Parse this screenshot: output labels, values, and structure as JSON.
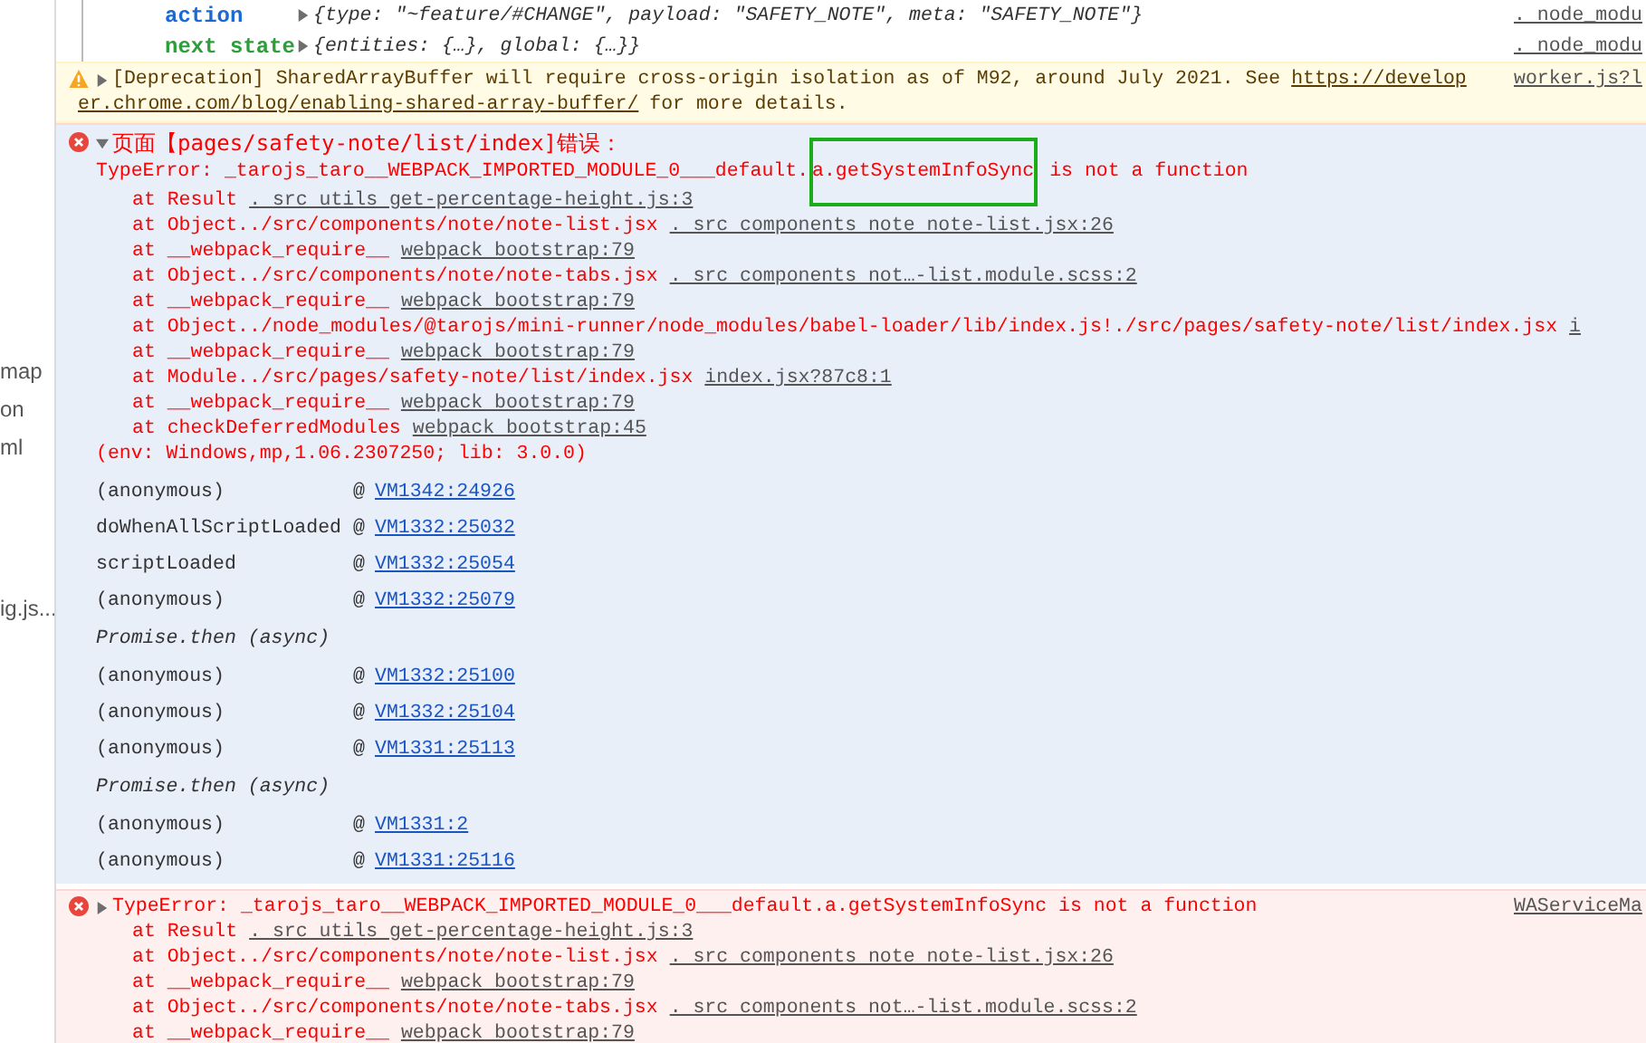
{
  "sidebar_fragments": [
    "map",
    "on",
    "ml",
    "ig.js..."
  ],
  "state_rows": [
    {
      "label": "action",
      "value": "{type: \"~feature/#CHANGE\", payload: \"SAFETY_NOTE\", meta: \"SAFETY_NOTE\"}",
      "source": ". node_modu"
    },
    {
      "label": "next state",
      "value": "{entities: {…}, global: {…}}",
      "source": ". node_modu"
    }
  ],
  "warning": {
    "text": "[Deprecation] SharedArrayBuffer will require cross-origin isolation as of M92, around July 2021. See",
    "link_start": "https://develop",
    "link_end": "er.chrome.com/blog/enabling-shared-array-buffer/",
    "text_end": "for more details.",
    "source": "worker.js?l"
  },
  "error_group": {
    "expanded": true,
    "title": "页面【pages/safety-note/list/index]错误：",
    "message_before": "TypeError: _tarojs_taro__WEBPACK_IMPORTED_MODULE_0___default.",
    "highlight": "a.getSystemInfoSync",
    "message_after": "is not a function",
    "stack": [
      {
        "text": "at Result",
        "link": ". src utils get-percentage-height.js:3"
      },
      {
        "text": "at Object../src/components/note/note-list.jsx",
        "link": ". src components note note-list.jsx:26"
      },
      {
        "text": "at __webpack_require__",
        "link": "webpack bootstrap:79"
      },
      {
        "text": "at Object../src/components/note/note-tabs.jsx",
        "link": ". src components not…-list.module.scss:2"
      },
      {
        "text": "at __webpack_require__",
        "link": "webpack bootstrap:79"
      },
      {
        "text": "at Object../node_modules/@tarojs/mini-runner/node_modules/babel-loader/lib/index.js!./src/pages/safety-note/list/index.jsx",
        "link": "i"
      },
      {
        "text": "at __webpack_require__",
        "link": "webpack bootstrap:79"
      },
      {
        "text": "at Module../src/pages/safety-note/list/index.jsx",
        "link": "index.jsx?87c8:1"
      },
      {
        "text": "at __webpack_require__",
        "link": "webpack bootstrap:79"
      },
      {
        "text": "at checkDeferredModules",
        "link": "webpack bootstrap:45"
      }
    ],
    "env": "(env: Windows,mp,1.06.2307250; lib: 3.0.0)",
    "call_stack": [
      {
        "kind": "frame",
        "name": "(anonymous)",
        "at": "@",
        "link": "VM1342:24926"
      },
      {
        "kind": "frame",
        "name": "doWhenAllScriptLoaded",
        "at": "@",
        "link": "VM1332:25032"
      },
      {
        "kind": "frame",
        "name": "scriptLoaded",
        "at": "@",
        "link": "VM1332:25054"
      },
      {
        "kind": "frame",
        "name": "(anonymous)",
        "at": "@",
        "link": "VM1332:25079"
      },
      {
        "kind": "async",
        "name": "Promise.then (async)"
      },
      {
        "kind": "frame",
        "name": "(anonymous)",
        "at": "@",
        "link": "VM1332:25100"
      },
      {
        "kind": "frame",
        "name": "(anonymous)",
        "at": "@",
        "link": "VM1332:25104"
      },
      {
        "kind": "frame",
        "name": "(anonymous)",
        "at": "@",
        "link": "VM1331:25113"
      },
      {
        "kind": "async",
        "name": "Promise.then (async)"
      },
      {
        "kind": "frame",
        "name": "(anonymous)",
        "at": "@",
        "link": "VM1331:2"
      },
      {
        "kind": "frame",
        "name": "(anonymous)",
        "at": "@",
        "link": "VM1331:25116"
      }
    ]
  },
  "error": {
    "expanded": false,
    "message": "TypeError: _tarojs_taro__WEBPACK_IMPORTED_MODULE_0___default.a.getSystemInfoSync is not a function",
    "source": "WAServiceMa",
    "stack": [
      {
        "text": "at Result",
        "link": ". src utils get-percentage-height.js:3"
      },
      {
        "text": "at Object../src/components/note/note-list.jsx",
        "link": ". src components note note-list.jsx:26"
      },
      {
        "text": "at __webpack_require__",
        "link": "webpack bootstrap:79"
      },
      {
        "text": "at Object../src/components/note/note-tabs.jsx",
        "link": ". src components not…-list.module.scss:2"
      },
      {
        "text": "at __webpack_require__",
        "link": "webpack bootstrap:79"
      }
    ]
  }
}
